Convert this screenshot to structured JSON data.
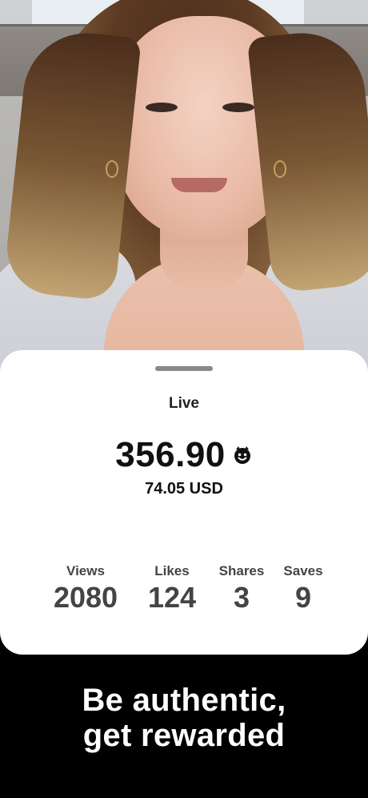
{
  "card": {
    "status_label": "Live",
    "amount": "356.90",
    "currency_icon": "coin-smiley-icon",
    "usd_value": "74.05 USD"
  },
  "stats": [
    {
      "label": "Views",
      "value": "2080"
    },
    {
      "label": "Likes",
      "value": "124"
    },
    {
      "label": "Shares",
      "value": "3"
    },
    {
      "label": "Saves",
      "value": "9"
    }
  ],
  "tagline": {
    "line1": "Be authentic,",
    "line2": "get rewarded"
  },
  "colors": {
    "card_background": "#ffffff",
    "page_background": "#000000",
    "text_primary": "#111111",
    "text_secondary": "#444444"
  }
}
